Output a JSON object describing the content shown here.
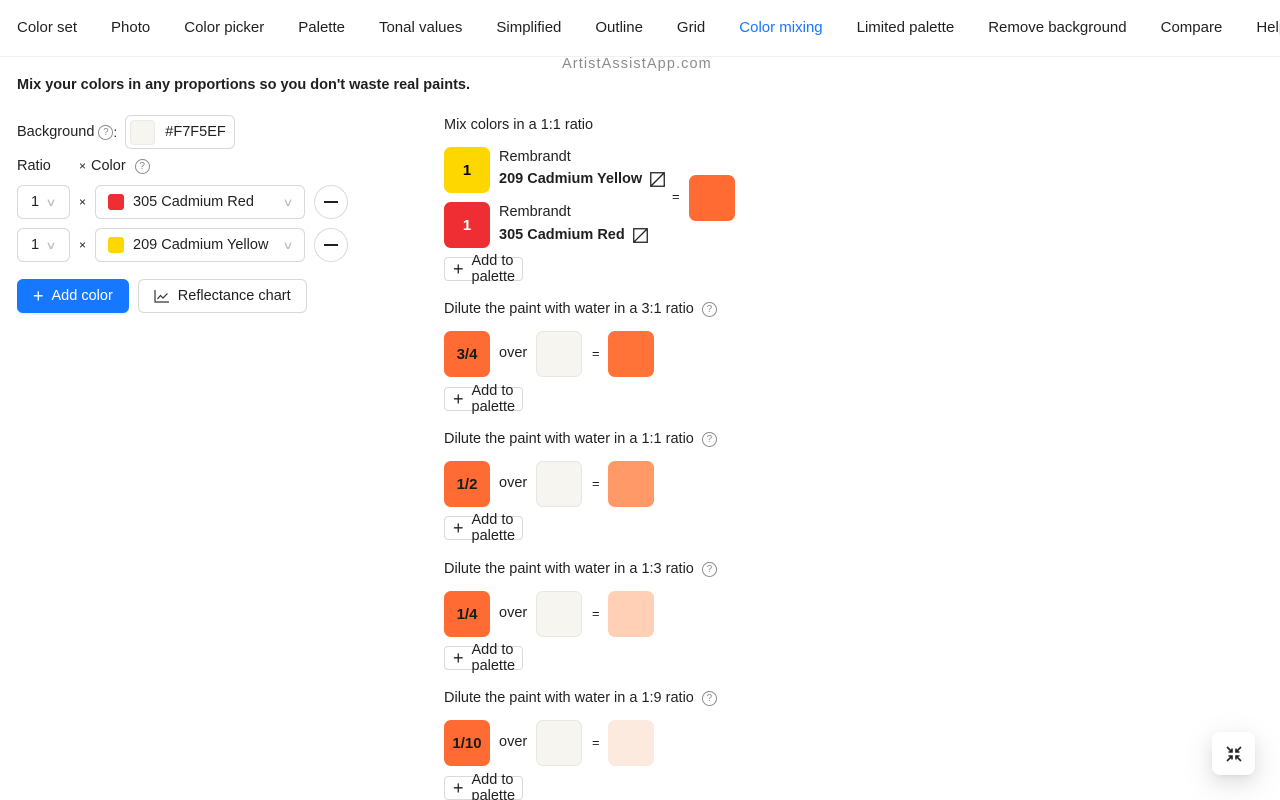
{
  "tabs": [
    {
      "label": "Color set",
      "active": false
    },
    {
      "label": "Photo",
      "active": false
    },
    {
      "label": "Color picker",
      "active": false
    },
    {
      "label": "Palette",
      "active": false
    },
    {
      "label": "Tonal values",
      "active": false
    },
    {
      "label": "Simplified",
      "active": false
    },
    {
      "label": "Outline",
      "active": false
    },
    {
      "label": "Grid",
      "active": false
    },
    {
      "label": "Color mixing",
      "active": true
    },
    {
      "label": "Limited palette",
      "active": false
    },
    {
      "label": "Remove background",
      "active": false
    },
    {
      "label": "Compare",
      "active": false
    },
    {
      "label": "Help",
      "active": false
    }
  ],
  "watermark": "ArtistAssistApp.com",
  "intro": "Mix your colors in any proportions so you don't waste real paints.",
  "background": {
    "label": "Background",
    "colon": ":",
    "help_icon": "question-circle-icon",
    "value": "#F7F5EF"
  },
  "mix_header": {
    "ratio": "Ratio",
    "times": "×",
    "color": "Color",
    "help_icon": "question-circle-icon"
  },
  "mix_rows": [
    {
      "ratio": "1",
      "times": "×",
      "color_name": "305 Cadmium Red",
      "swatch": "#EE2E32"
    },
    {
      "ratio": "1",
      "times": "×",
      "color_name": "209 Cadmium Yellow",
      "swatch": "#FFD700"
    }
  ],
  "buttons": {
    "add_color": "Add color",
    "reflectance_chart": "Reflectance chart",
    "add_to_palette": "Add to palette"
  },
  "result": {
    "title": "Mix colors in a 1:1 ratio",
    "paints": [
      {
        "ratio": "1",
        "brand": "Rembrandt",
        "name": "209 Cadmium Yellow",
        "color": "#FFD700",
        "text_color": "#000000"
      },
      {
        "ratio": "1",
        "brand": "Rembrandt",
        "name": "305 Cadmium Red",
        "color": "#EE2E32",
        "text_color": "#FFFFFF"
      }
    ],
    "equals": "=",
    "mixed_color": "#FF6B33"
  },
  "dilutions": [
    {
      "title": "Dilute the paint with water in a 3:1 ratio",
      "fraction": "3/4",
      "over": "over",
      "equals": "=",
      "result_color": "#FF7238"
    },
    {
      "title": "Dilute the paint with water in a 1:1 ratio",
      "fraction": "1/2",
      "over": "over",
      "equals": "=",
      "result_color": "#FF9A68"
    },
    {
      "title": "Dilute the paint with water in a 1:3 ratio",
      "fraction": "1/4",
      "over": "over",
      "equals": "=",
      "result_color": "#FFD0B5"
    },
    {
      "title": "Dilute the paint with water in a 1:9 ratio",
      "fraction": "1/10",
      "over": "over",
      "equals": "=",
      "result_color": "#FCEADF"
    }
  ],
  "colors": {
    "accent": "#1677ff",
    "base_paint": "#FF6B33",
    "paper": "#F7F5EF"
  },
  "fab": {
    "icon": "compress-icon"
  }
}
